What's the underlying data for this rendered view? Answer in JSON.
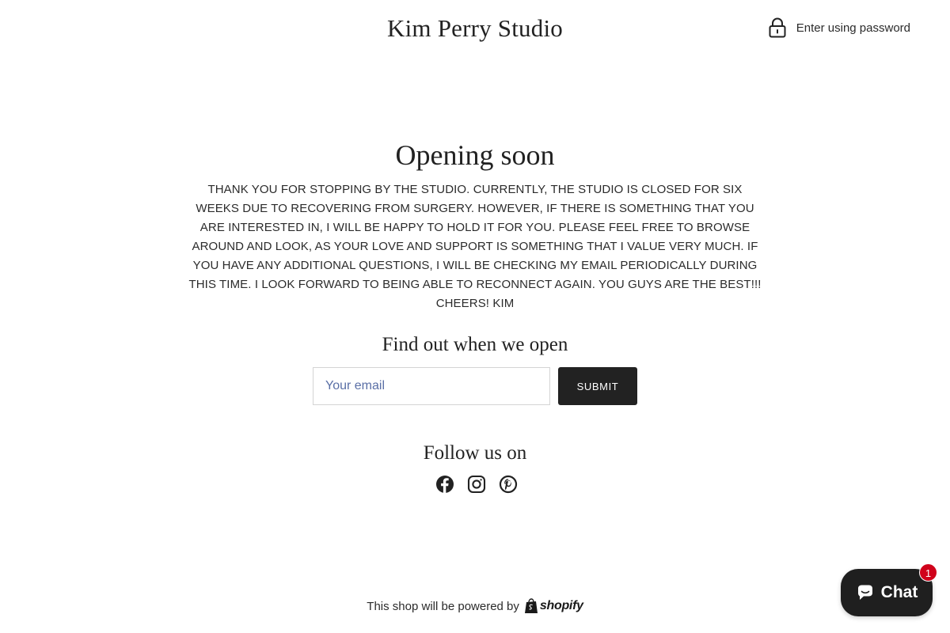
{
  "header": {
    "store_name": "Kim Perry Studio",
    "password_link_label": "Enter using password",
    "password_icon": "lock-icon"
  },
  "main": {
    "headline": "Opening soon",
    "message": "THANK YOU FOR STOPPING BY THE STUDIO. CURRENTLY, THE STUDIO IS CLOSED FOR SIX WEEKS DUE TO RECOVERING FROM SURGERY. HOWEVER, IF THERE IS SOMETHING THAT YOU ARE INTERESTED IN, I WILL BE HAPPY TO HOLD IT FOR YOU. PLEASE FEEL FREE TO BROWSE AROUND AND LOOK, AS YOUR LOVE AND SUPPORT IS SOMETHING THAT I VALUE VERY MUCH. IF YOU HAVE ANY ADDITIONAL QUESTIONS, I WILL BE CHECKING MY EMAIL PERIODICALLY DURING THIS TIME. I LOOK FORWARD TO BEING ABLE TO RECONNECT AGAIN. YOU GUYS ARE THE BEST!!! CHEERS! KIM"
  },
  "signup": {
    "title": "Find out when we open",
    "email_value": "",
    "email_placeholder": "Your email",
    "submit_label": "SUBMIT"
  },
  "social": {
    "title": "Follow us on",
    "icons": [
      "facebook-icon",
      "instagram-icon",
      "pinterest-icon"
    ]
  },
  "footer": {
    "powered_text": "This shop will be powered by",
    "shopify_label": "shopify"
  },
  "chat": {
    "label": "Chat",
    "badge_count": "1",
    "icon": "chat-bubble-icon"
  },
  "colors": {
    "button_bg": "#222222",
    "badge_bg": "#d0021b",
    "placeholder": "#5a6fa6"
  }
}
